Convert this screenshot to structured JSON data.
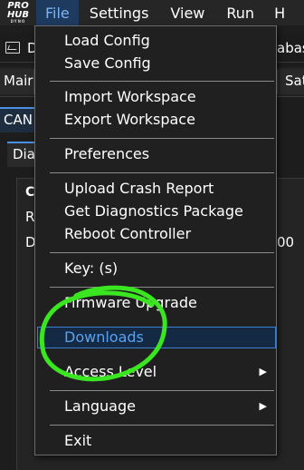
{
  "logo": {
    "line1": "PRO",
    "line2": "HUB",
    "line3": "DYNO"
  },
  "menubar": {
    "items": [
      "File",
      "Settings",
      "View",
      "Run",
      "H"
    ]
  },
  "background": {
    "toolbar_d": "D",
    "toolbar_right": "abas",
    "tab_main": "Mair",
    "tab_right": "Sat",
    "subtab_can": "CAN",
    "subtab_dia": "Dia",
    "panel_line1": "C",
    "panel_line2": "R",
    "panel_line3": "D",
    "panel_value": "00"
  },
  "file_menu": {
    "load_config": "Load Config",
    "save_config": "Save Config",
    "import_workspace": "Import Workspace",
    "export_workspace": "Export Workspace",
    "preferences": "Preferences",
    "upload_crash_report": "Upload Crash Report",
    "get_diagnostics_package": "Get Diagnostics Package",
    "reboot_controller": "Reboot Controller",
    "key": "Key:  (s)",
    "firmware_upgrade": "Firmware Upgrade",
    "downloads": "Downloads",
    "access_level": "Access Level",
    "language": "Language",
    "exit": "Exit",
    "submenu_arrow": "▶"
  },
  "colors": {
    "menubar_bg": "#262626",
    "active_menu_bg": "#1f3a5f",
    "active_menu_text": "#7db3f0",
    "highlight_border": "#3c7ecf",
    "highlight_text": "#5aa1ee",
    "annotation": "#39e61f"
  }
}
